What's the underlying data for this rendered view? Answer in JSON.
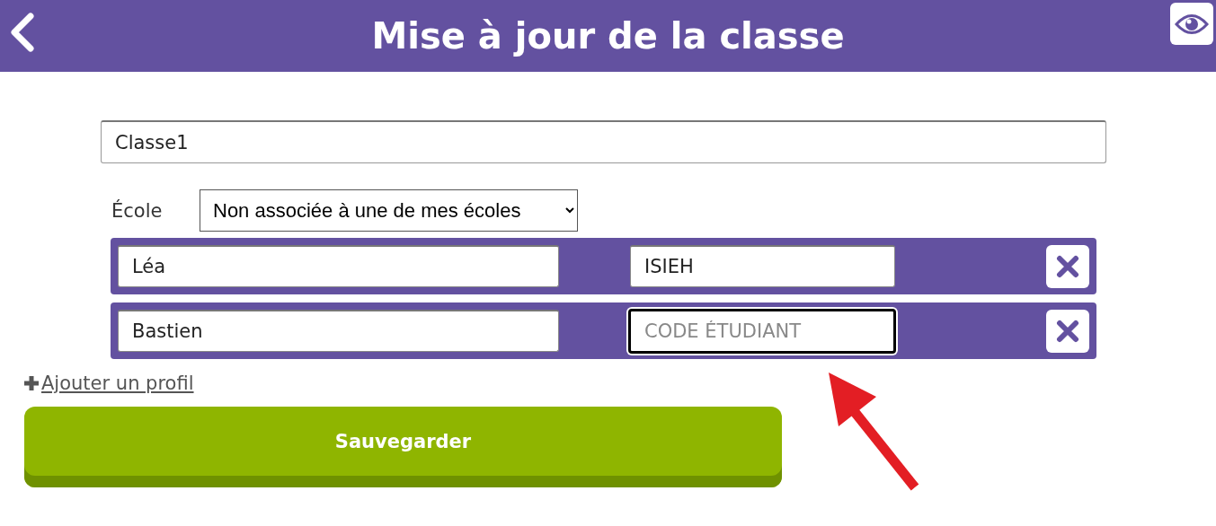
{
  "header": {
    "title": "Mise à jour de la classe"
  },
  "class_name": {
    "value": "Classe1"
  },
  "school": {
    "label": "École",
    "value": "Non associée à une de mes écoles"
  },
  "profiles": [
    {
      "name": "Léa",
      "code": {
        "value": "ISIEH",
        "focused": false
      }
    },
    {
      "name": "Bastien",
      "code": {
        "placeholder": "CODE ÉTUDIANT",
        "focused": true
      }
    }
  ],
  "add_profile": {
    "label": "Ajouter un profil"
  },
  "save_button": {
    "label": "Sauvegarder"
  },
  "annotation": {
    "kind": "arrow"
  }
}
